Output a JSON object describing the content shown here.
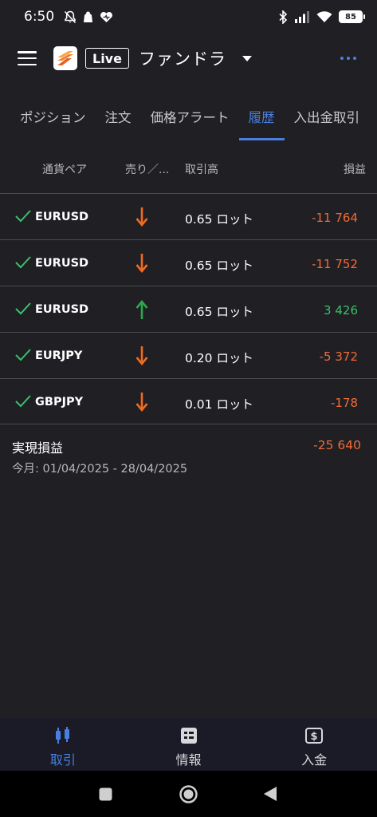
{
  "status_bar": {
    "time": "6:50",
    "battery": "85",
    "icons": [
      "notifications-off-icon",
      "app-notification-icon",
      "heart-icon",
      "bluetooth-icon",
      "signal-icon",
      "wifi-icon",
      "battery-icon"
    ]
  },
  "app_bar": {
    "badge": "Live",
    "account_name": "ファンドラ"
  },
  "tabs": [
    {
      "label": "ポジション",
      "active": false
    },
    {
      "label": "注文",
      "active": false
    },
    {
      "label": "価格アラート",
      "active": false
    },
    {
      "label": "履歴",
      "active": true
    },
    {
      "label": "入出金取引",
      "active": false
    }
  ],
  "table": {
    "headers": {
      "pair": "通貨ペア",
      "direction": "売り／...",
      "volume": "取引高",
      "pnl": "損益"
    },
    "rows": [
      {
        "pair": "EURUSD",
        "direction": "sell",
        "volume": "0.65 ロット",
        "pnl": "-11 764",
        "pnl_sign": "neg"
      },
      {
        "pair": "EURUSD",
        "direction": "sell",
        "volume": "0.65 ロット",
        "pnl": "-11 752",
        "pnl_sign": "neg"
      },
      {
        "pair": "EURUSD",
        "direction": "buy",
        "volume": "0.65 ロット",
        "pnl": "3 426",
        "pnl_sign": "pos"
      },
      {
        "pair": "EURJPY",
        "direction": "sell",
        "volume": "0.20 ロット",
        "pnl": "-5 372",
        "pnl_sign": "neg"
      },
      {
        "pair": "GBPJPY",
        "direction": "sell",
        "volume": "0.01 ロット",
        "pnl": "-178",
        "pnl_sign": "neg"
      }
    ]
  },
  "summary": {
    "label": "実現損益",
    "value": "-25 640",
    "period": "今月: 01/04/2025 - 28/04/2025"
  },
  "bottom_nav": [
    {
      "label": "取引",
      "icon": "candlestick-icon",
      "active": true
    },
    {
      "label": "情報",
      "icon": "news-icon",
      "active": false
    },
    {
      "label": "入金",
      "icon": "deposit-icon",
      "active": false
    }
  ],
  "colors": {
    "background": "#1f1f24",
    "accent": "#4a7fe0",
    "negative": "#f26b36",
    "positive": "#3cbf6b",
    "sell_arrow": "#f26b1d",
    "buy_arrow": "#2ea84f"
  }
}
